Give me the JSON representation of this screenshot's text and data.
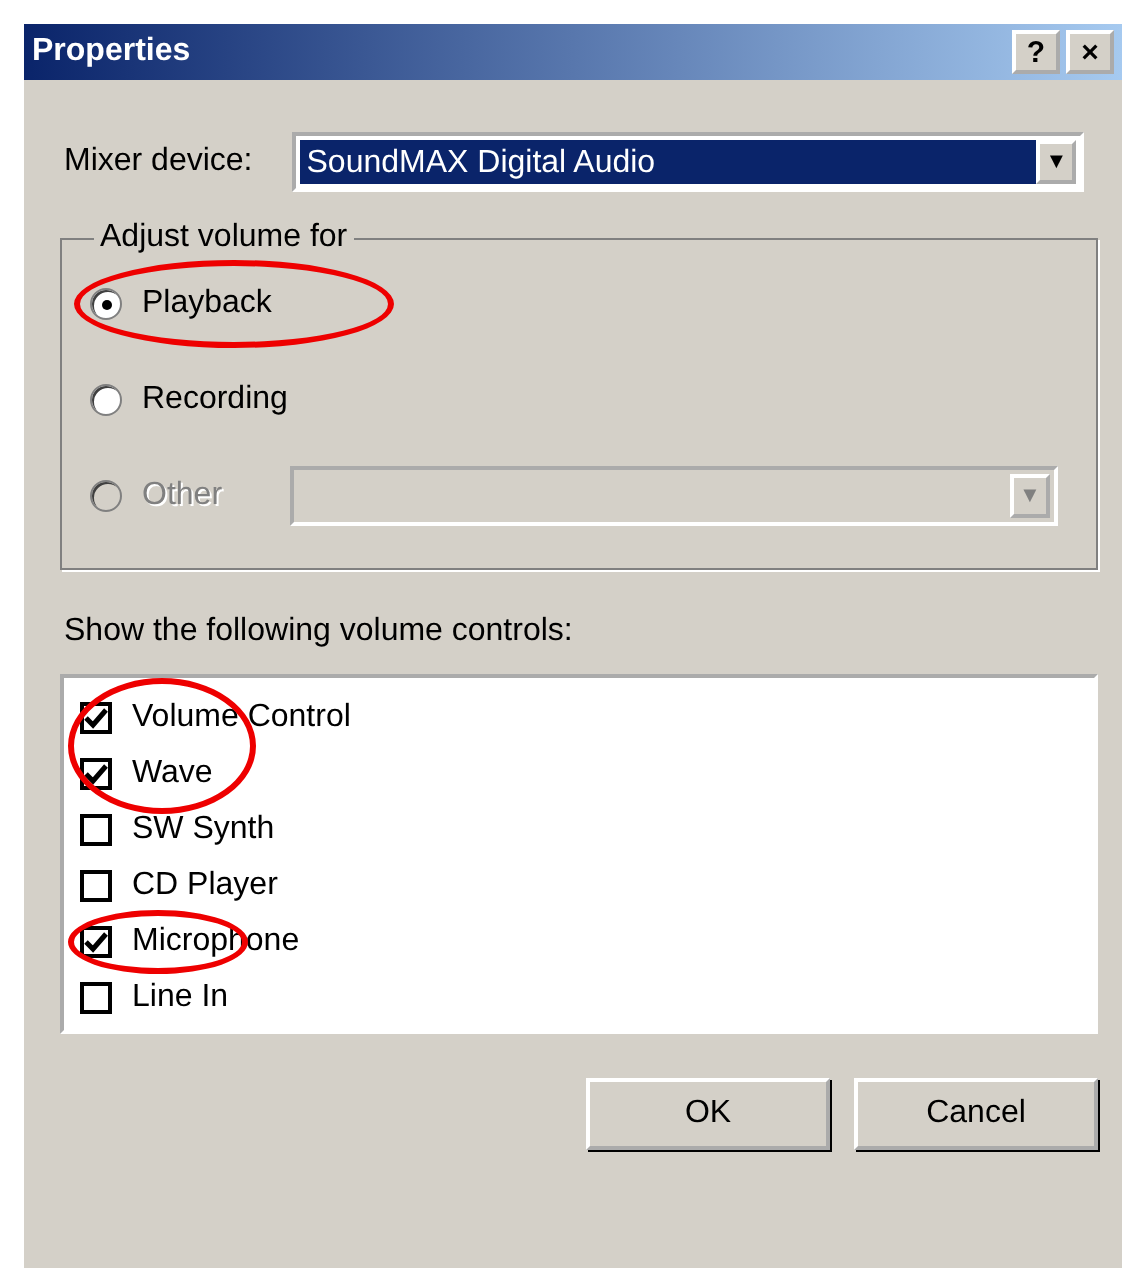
{
  "window": {
    "title": "Properties",
    "title_buttons": [
      "?",
      "×"
    ]
  },
  "mixer": {
    "label": "Mixer device:",
    "value": "SoundMAX Digital Audio",
    "arrow": "▼"
  },
  "adjust_group": {
    "title": "Adjust volume for",
    "options": [
      {
        "label": "Playback",
        "selected": true,
        "disabled": false,
        "highlighted": true
      },
      {
        "label": "Recording",
        "selected": false,
        "disabled": false,
        "highlighted": false
      },
      {
        "label": "Other",
        "selected": false,
        "disabled": true,
        "highlighted": false,
        "combo_arrow": "▼"
      }
    ]
  },
  "controls": {
    "label": "Show the following volume controls:",
    "items": [
      {
        "label": "Volume Control",
        "checked": true,
        "highlighted": true
      },
      {
        "label": "Wave",
        "checked": true,
        "highlighted": true
      },
      {
        "label": "SW Synth",
        "checked": false,
        "highlighted": false
      },
      {
        "label": "CD Player",
        "checked": false,
        "highlighted": false
      },
      {
        "label": "Microphone",
        "checked": true,
        "highlighted": true
      },
      {
        "label": "Line In",
        "checked": false,
        "highlighted": false
      }
    ]
  },
  "buttons": [
    "OK",
    "Cancel"
  ]
}
